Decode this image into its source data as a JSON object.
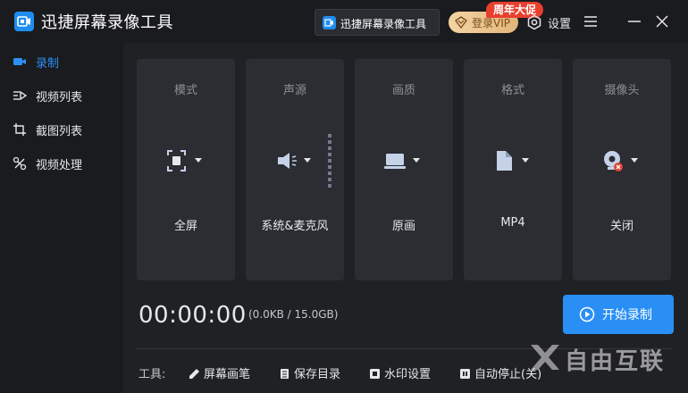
{
  "app": {
    "title": "迅捷屏幕录像工具",
    "chip_label": "迅捷屏幕录像工具",
    "vip_label": "登录VIP",
    "promo_badge": "周年大促",
    "settings_label": "设置"
  },
  "sidebar": {
    "items": [
      {
        "label": "录制",
        "icon": "video-camera-icon",
        "active": true
      },
      {
        "label": "视频列表",
        "icon": "video-list-icon",
        "active": false
      },
      {
        "label": "截图列表",
        "icon": "screenshot-list-icon",
        "active": false
      },
      {
        "label": "视频处理",
        "icon": "video-process-icon",
        "active": false
      }
    ]
  },
  "cards": [
    {
      "title": "模式",
      "value": "全屏",
      "icon": "fullscreen-icon"
    },
    {
      "title": "声源",
      "value": "系统&麦克风",
      "icon": "speaker-icon"
    },
    {
      "title": "画质",
      "value": "原画",
      "icon": "monitor-icon"
    },
    {
      "title": "格式",
      "value": "MP4",
      "icon": "file-icon"
    },
    {
      "title": "摄像头",
      "value": "关闭",
      "icon": "webcam-off-icon"
    }
  ],
  "recording": {
    "timer": "00:00:00",
    "storage": "(0.0KB / 15.0GB)",
    "start_label": "开始录制"
  },
  "tools": {
    "label": "工具:",
    "items": [
      {
        "label": "屏幕画笔",
        "icon": "pen-icon"
      },
      {
        "label": "保存目录",
        "icon": "folder-doc-icon"
      },
      {
        "label": "水印设置",
        "icon": "watermark-icon"
      },
      {
        "label": "自动停止(关)",
        "icon": "auto-stop-icon"
      }
    ]
  },
  "watermark_text": "自由互联",
  "colors": {
    "accent": "#2a8ff4",
    "background": "#202125",
    "card": "#2b2d32",
    "promo": "#e8402f",
    "vip_gold": "#e2b579"
  }
}
